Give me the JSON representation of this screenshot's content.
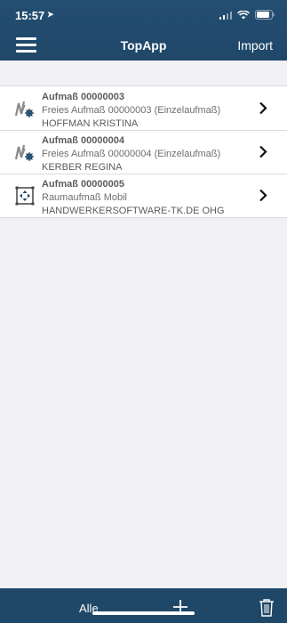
{
  "status_bar": {
    "time": "15:57"
  },
  "header": {
    "title": "TopApp",
    "import_label": "Import"
  },
  "list": {
    "items": [
      {
        "title": "Aufmaß 00000003",
        "subtitle": "Freies Aufmaß 00000003 (Einzelaufmaß)",
        "name": "HOFFMAN KRISTINA",
        "icon": "measure-free-icon"
      },
      {
        "title": "Aufmaß 00000004",
        "subtitle": "Freies Aufmaß 00000004 (Einzelaufmaß)",
        "name": "KERBER REGINA",
        "icon": "measure-free-icon"
      },
      {
        "title": "Aufmaß 00000005",
        "subtitle": "Raumaufmaß Mobil",
        "name": "HANDWERKERSOFTWARE-TK.DE OHG",
        "icon": "room-measure-icon"
      }
    ]
  },
  "toolbar": {
    "filter_label": "Alle"
  },
  "colors": {
    "bar": "#1f4768",
    "background": "#f0f0f5"
  }
}
